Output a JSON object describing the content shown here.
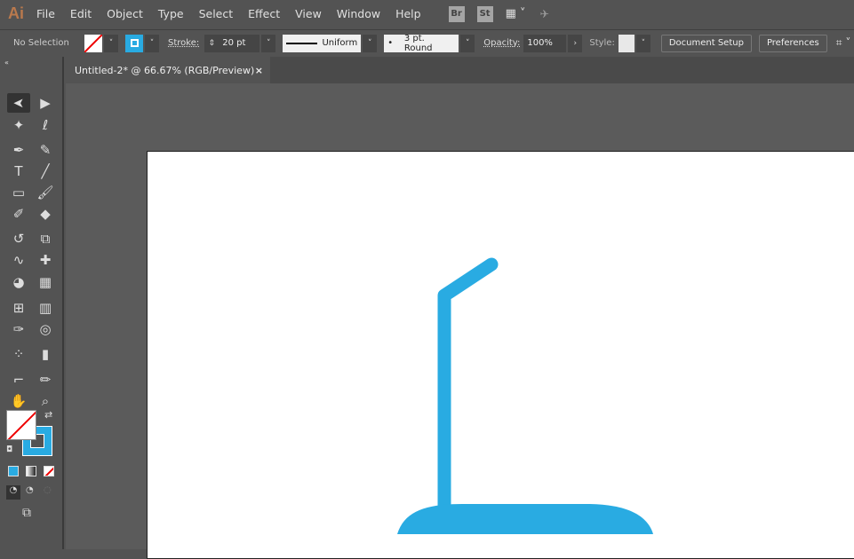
{
  "app": {
    "logo": "Ai",
    "menus": [
      "File",
      "Edit",
      "Object",
      "Type",
      "Select",
      "Effect",
      "View",
      "Window",
      "Help"
    ],
    "bridge": "Br",
    "stock": "St"
  },
  "control": {
    "selection": "No Selection",
    "stroke_label": "Stroke:",
    "stroke_value": "20 pt",
    "profile": "Uniform",
    "brush": "3 pt. Round",
    "opacity_label": "Opacity:",
    "opacity_value": "100%",
    "style_label": "Style:",
    "document_setup": "Document Setup",
    "preferences": "Preferences"
  },
  "document": {
    "tab_title": "Untitled-2* @ 66.67% (RGB/Preview)",
    "close": "×"
  },
  "colors": {
    "stroke": "#29abe2",
    "fill": "none",
    "accent": "#29abe2"
  },
  "tools": [
    "selection",
    "direct-selection",
    "magic-wand",
    "lasso",
    "pen",
    "curvature",
    "type",
    "line",
    "rectangle",
    "paintbrush",
    "shaper",
    "eraser",
    "rotate",
    "scale",
    "warp",
    "puppet-warp",
    "shape-builder",
    "perspective-grid",
    "mesh",
    "gradient",
    "eyedropper",
    "blend",
    "symbol-sprayer",
    "graph",
    "artboard",
    "slice",
    "hand",
    "zoom"
  ]
}
